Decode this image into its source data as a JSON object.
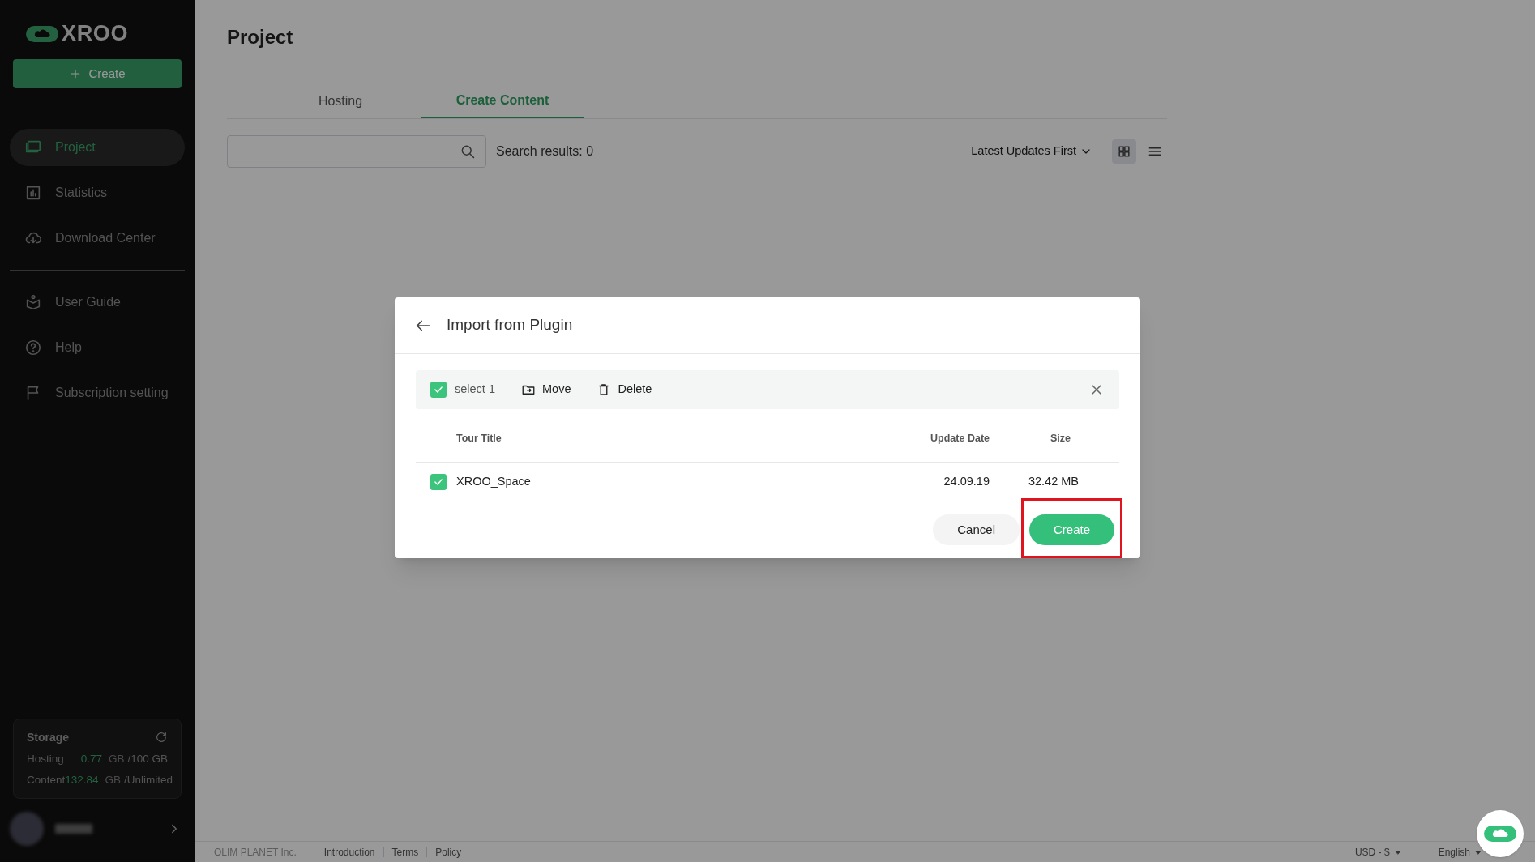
{
  "sidebar": {
    "logo": "XROO",
    "create_button": "Create",
    "nav": [
      {
        "kind": "project",
        "label": "Project",
        "selected": true
      },
      {
        "kind": "statistics",
        "label": "Statistics",
        "selected": false
      },
      {
        "kind": "download",
        "label": "Download Center",
        "selected": false
      },
      {
        "kind": "guide",
        "label": "User Guide",
        "selected": false
      },
      {
        "kind": "help",
        "label": "Help",
        "selected": false
      },
      {
        "kind": "subscription",
        "label": "Subscription setting",
        "selected": false
      }
    ],
    "storage": {
      "title": "Storage",
      "rows": [
        {
          "label": "Hosting",
          "used": "0.77",
          "unit": "GB",
          "total": "/100 GB"
        },
        {
          "label": "Content",
          "used": "132.84",
          "unit": "GB",
          "total": "/Unlimited"
        }
      ]
    }
  },
  "main": {
    "title": "Project",
    "tabs": [
      {
        "label": "Hosting",
        "selected": false
      },
      {
        "label": "Create Content",
        "selected": true
      }
    ],
    "search_results": "Search results: 0",
    "sort": "Latest Updates First",
    "view_modes": [
      {
        "kind": "grid",
        "selected": true
      },
      {
        "kind": "list",
        "selected": false
      }
    ]
  },
  "dialog": {
    "title": "Import from Plugin",
    "toolbar": {
      "checked": true,
      "label": "select 1",
      "actions": [
        {
          "kind": "move",
          "label": "Move"
        },
        {
          "kind": "delete",
          "label": "Delete"
        }
      ]
    },
    "columns": [
      "Tour Title",
      "Update Date",
      "Size"
    ],
    "rows": [
      {
        "checked": true,
        "title": "XROO_Space",
        "date": "24.09.19",
        "size": "32.42 MB"
      }
    ],
    "buttons": [
      {
        "kind": "secondary",
        "label": "Cancel",
        "highlighted": false
      },
      {
        "kind": "primary",
        "label": "Create",
        "highlighted": true
      }
    ]
  },
  "footer": {
    "company": "OLIM PLANET Inc.",
    "links": [
      "Introduction",
      "Terms",
      "Policy"
    ],
    "currency": "USD - $",
    "language": "English"
  }
}
